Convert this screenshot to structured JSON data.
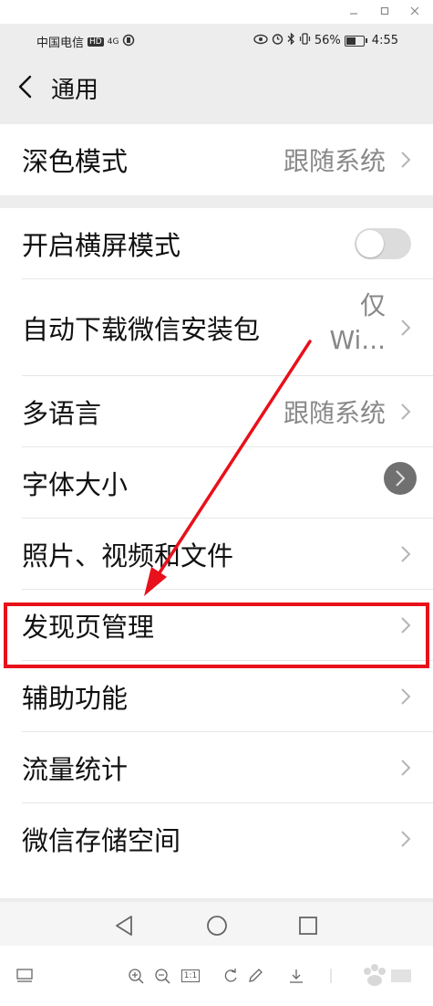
{
  "status_bar": {
    "carrier": "中国电信",
    "hd_badge": "HD",
    "network": "4G",
    "battery": "56%",
    "time": "4:55"
  },
  "nav": {
    "title": "通用"
  },
  "settings": {
    "dark_mode": {
      "label": "深色模式",
      "value": "跟随系统"
    },
    "landscape": {
      "label": "开启横屏模式",
      "enabled": false
    },
    "auto_download": {
      "label": "自动下载微信安装包",
      "value_line1": "仅",
      "value_line2": "Wi..."
    },
    "language": {
      "label": "多语言",
      "value": "跟随系统"
    },
    "font_size": {
      "label": "字体大小"
    },
    "media": {
      "label": "照片、视频和文件"
    },
    "discover": {
      "label": "发现页管理"
    },
    "accessibility": {
      "label": "辅助功能"
    },
    "data_usage": {
      "label": "流量统计"
    },
    "storage": {
      "label": "微信存储空间"
    }
  },
  "toolbar": {
    "zoom_ratio": "1:1"
  },
  "colors": {
    "highlight": "#e8101a",
    "background": "#ededed",
    "row": "#ffffff"
  }
}
